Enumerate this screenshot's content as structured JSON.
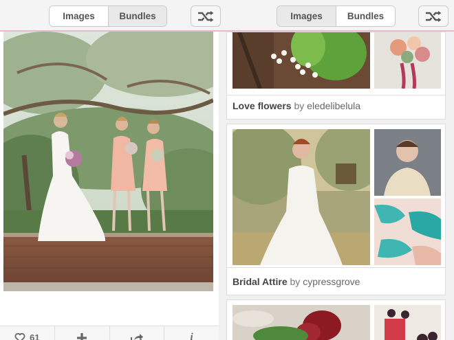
{
  "topbar": {
    "left_tabs": [
      {
        "label": "Images",
        "active": true
      },
      {
        "label": "Bundles",
        "active": false
      }
    ],
    "right_tabs": [
      {
        "label": "Images",
        "active": false
      },
      {
        "label": "Bundles",
        "active": true
      }
    ],
    "shuffle_icon": "shuffle-icon"
  },
  "pin": {
    "photo_subject": "bride-and-bridesmaids-photo",
    "actions": {
      "like_count": "61",
      "like_icon": "heart-icon",
      "add_icon": "plus-icon",
      "share_icon": "share-icon",
      "info_icon": "i"
    }
  },
  "bundles": [
    {
      "title": "Love flowers",
      "by": "by",
      "author": "eledelibelula"
    },
    {
      "title": "Bridal Attire",
      "by": "by",
      "author": "cypressgrove"
    }
  ],
  "colors": {
    "accent_line": "#e8b9d0",
    "text": "#555555"
  }
}
